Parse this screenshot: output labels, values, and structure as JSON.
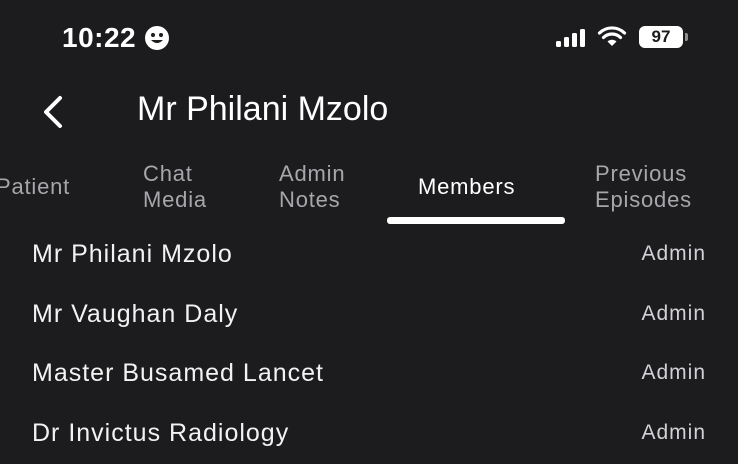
{
  "status_bar": {
    "time": "10:22",
    "battery_level": "97",
    "icons": [
      "smiley-icon",
      "signal-icon",
      "wifi-icon",
      "battery-icon"
    ]
  },
  "header": {
    "title": "Mr Philani Mzolo",
    "back_icon": "chevron-left-icon"
  },
  "tabs": [
    {
      "line1": "Patient",
      "line2": ""
    },
    {
      "line1": "Chat",
      "line2": "Media"
    },
    {
      "line1": "Admin",
      "line2": "Notes"
    },
    {
      "line1": "Members",
      "line2": ""
    },
    {
      "line1": "Previous",
      "line2": "Episodes"
    }
  ],
  "active_tab": "Members",
  "members": [
    {
      "name": "Mr Philani Mzolo",
      "role": "Admin"
    },
    {
      "name": "Mr Vaughan Daly",
      "role": "Admin"
    },
    {
      "name": "Master Busamed Lancet",
      "role": "Admin"
    },
    {
      "name": "Dr Invictus Radiology",
      "role": "Admin"
    }
  ],
  "colors": {
    "background": "#1c1c1e",
    "text": "#ffffff",
    "muted": "#a7a7ab",
    "indicator": "#ffffff"
  }
}
